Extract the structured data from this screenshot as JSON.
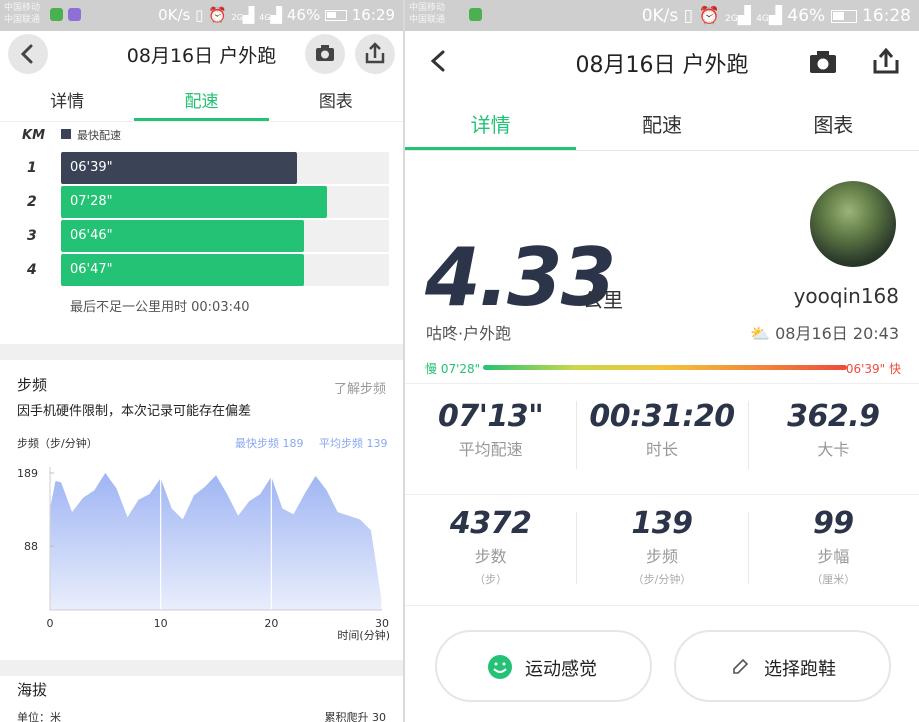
{
  "left": {
    "status": {
      "carrier1": "中国移动",
      "carrier2": "中国联通",
      "net": "0K/s",
      "sig1": "2G",
      "sig2": "4G",
      "battery": "46%",
      "time": "16:29"
    },
    "header": {
      "title": "08月16日 户外跑"
    },
    "tabs": [
      "详情",
      "配速",
      "图表"
    ],
    "pace": {
      "km_label": "KM",
      "legend": "最快配速",
      "rows": [
        {
          "km": "1",
          "pace": "06'39\"",
          "fill": 0.72,
          "fastest": true
        },
        {
          "km": "2",
          "pace": "07'28\"",
          "fill": 0.81,
          "fastest": false
        },
        {
          "km": "3",
          "pace": "06'46\"",
          "fill": 0.74,
          "fastest": false
        },
        {
          "km": "4",
          "pace": "06'47\"",
          "fill": 0.74,
          "fastest": false
        }
      ],
      "remainder": "最后不足一公里用时 00:03:40"
    },
    "cadence": {
      "title": "步频",
      "link": "了解步频",
      "note": "因手机硬件限制，本次记录可能存在偏差",
      "ylabel": "步频（步/分钟）",
      "fastest": "最快步频 189",
      "average": "平均步频 139",
      "xlabel": "时间(分钟)"
    },
    "altitude": {
      "title": "海拔",
      "unit": "单位：米",
      "climb": "累积爬升 30"
    }
  },
  "chart_data": {
    "type": "area",
    "title": "",
    "xlabel": "时间(分钟)",
    "ylabel": "步频（步/分钟）",
    "x_ticks": [
      "0",
      "10",
      "20",
      "30"
    ],
    "y_ticks": [
      "189",
      "88"
    ],
    "xlim": [
      0,
      30
    ],
    "ylim": [
      0,
      189
    ],
    "grid": true,
    "series": [
      {
        "x": [
          0,
          0.5,
          1,
          2,
          3,
          4,
          5,
          6,
          7,
          8,
          9,
          10,
          11,
          12,
          13,
          14,
          15,
          16,
          17,
          18,
          19,
          20,
          21,
          22,
          23,
          24,
          25,
          26,
          27,
          28,
          29,
          30
        ],
        "values": [
          140,
          178,
          176,
          135,
          155,
          165,
          189,
          168,
          128,
          152,
          160,
          182,
          140,
          125,
          158,
          170,
          186,
          160,
          130,
          150,
          160,
          184,
          140,
          132,
          160,
          185,
          165,
          135,
          130,
          125,
          110,
          10
        ]
      }
    ]
  },
  "right": {
    "status": {
      "carrier1": "中国移动",
      "carrier2": "中国联通",
      "net": "0K/s",
      "sig1": "2G",
      "sig2": "4G",
      "battery": "46%",
      "time": "16:28"
    },
    "header": {
      "title": "08月16日 户外跑"
    },
    "tabs": [
      "详情",
      "配速",
      "图表"
    ],
    "distance": "4.33",
    "dist_unit": "公里",
    "username": "yooqin168",
    "activity": "咕咚·户外跑",
    "datetime": "08月16日 20:43",
    "range": {
      "slow": "慢 07'28\"",
      "fast": "06'39\" 快"
    },
    "stats": [
      {
        "value": "07'13\"",
        "label": "平均配速",
        "unit": ""
      },
      {
        "value": "00:31:20",
        "label": "时长",
        "unit": ""
      },
      {
        "value": "362.9",
        "label": "大卡",
        "unit": ""
      },
      {
        "value": "4372",
        "label": "步数",
        "unit": "（步）"
      },
      {
        "value": "139",
        "label": "步频",
        "unit": "（步/分钟）"
      },
      {
        "value": "99",
        "label": "步幅",
        "unit": "（厘米）"
      }
    ],
    "buttons": {
      "feel": "运动感觉",
      "shoes": "选择跑鞋"
    }
  },
  "colors": {
    "green": "#24c274",
    "dark": "#3a4456",
    "light_bg": "#f0f0f0"
  }
}
